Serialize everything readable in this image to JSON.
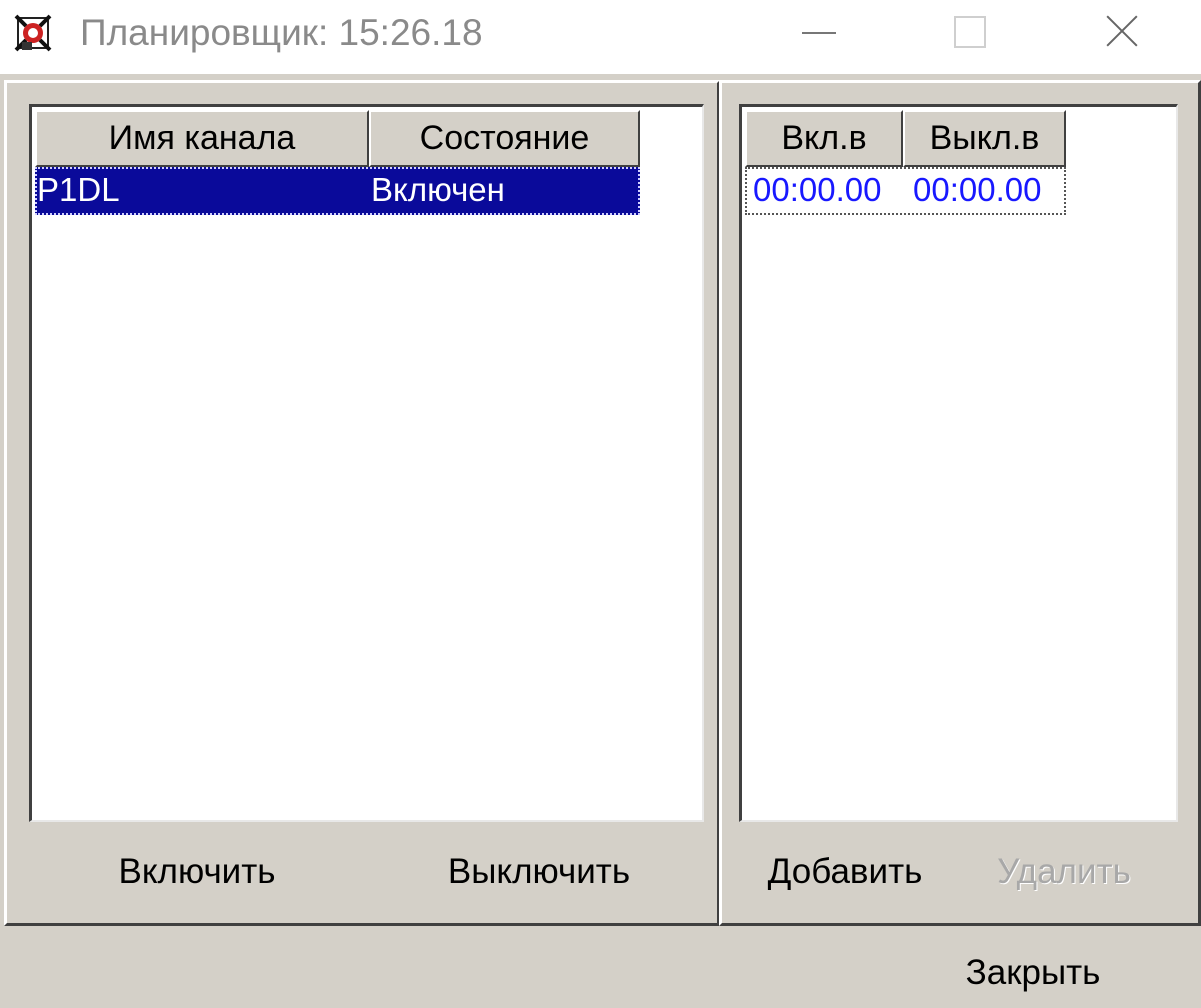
{
  "titlebar": {
    "title": "Планировщик: 15:26.18",
    "icon": "app-icon"
  },
  "channels": {
    "columns": {
      "name": "Имя канала",
      "state": "Состояние"
    },
    "rows": [
      {
        "name": "P1DL",
        "state": "Включен",
        "selected": true
      }
    ],
    "buttons": {
      "enable": "Включить",
      "disable": "Выключить"
    }
  },
  "schedule": {
    "columns": {
      "on": "Вкл.в",
      "off": "Выкл.в"
    },
    "rows": [
      {
        "on": "00:00.00",
        "off": "00:00.00"
      }
    ],
    "buttons": {
      "add": "Добавить",
      "delete": "Удалить"
    }
  },
  "footer": {
    "close": "Закрыть"
  },
  "colors": {
    "selection": "#0a0a9a",
    "time_text": "#1818ff",
    "face": "#d4d0c8"
  }
}
